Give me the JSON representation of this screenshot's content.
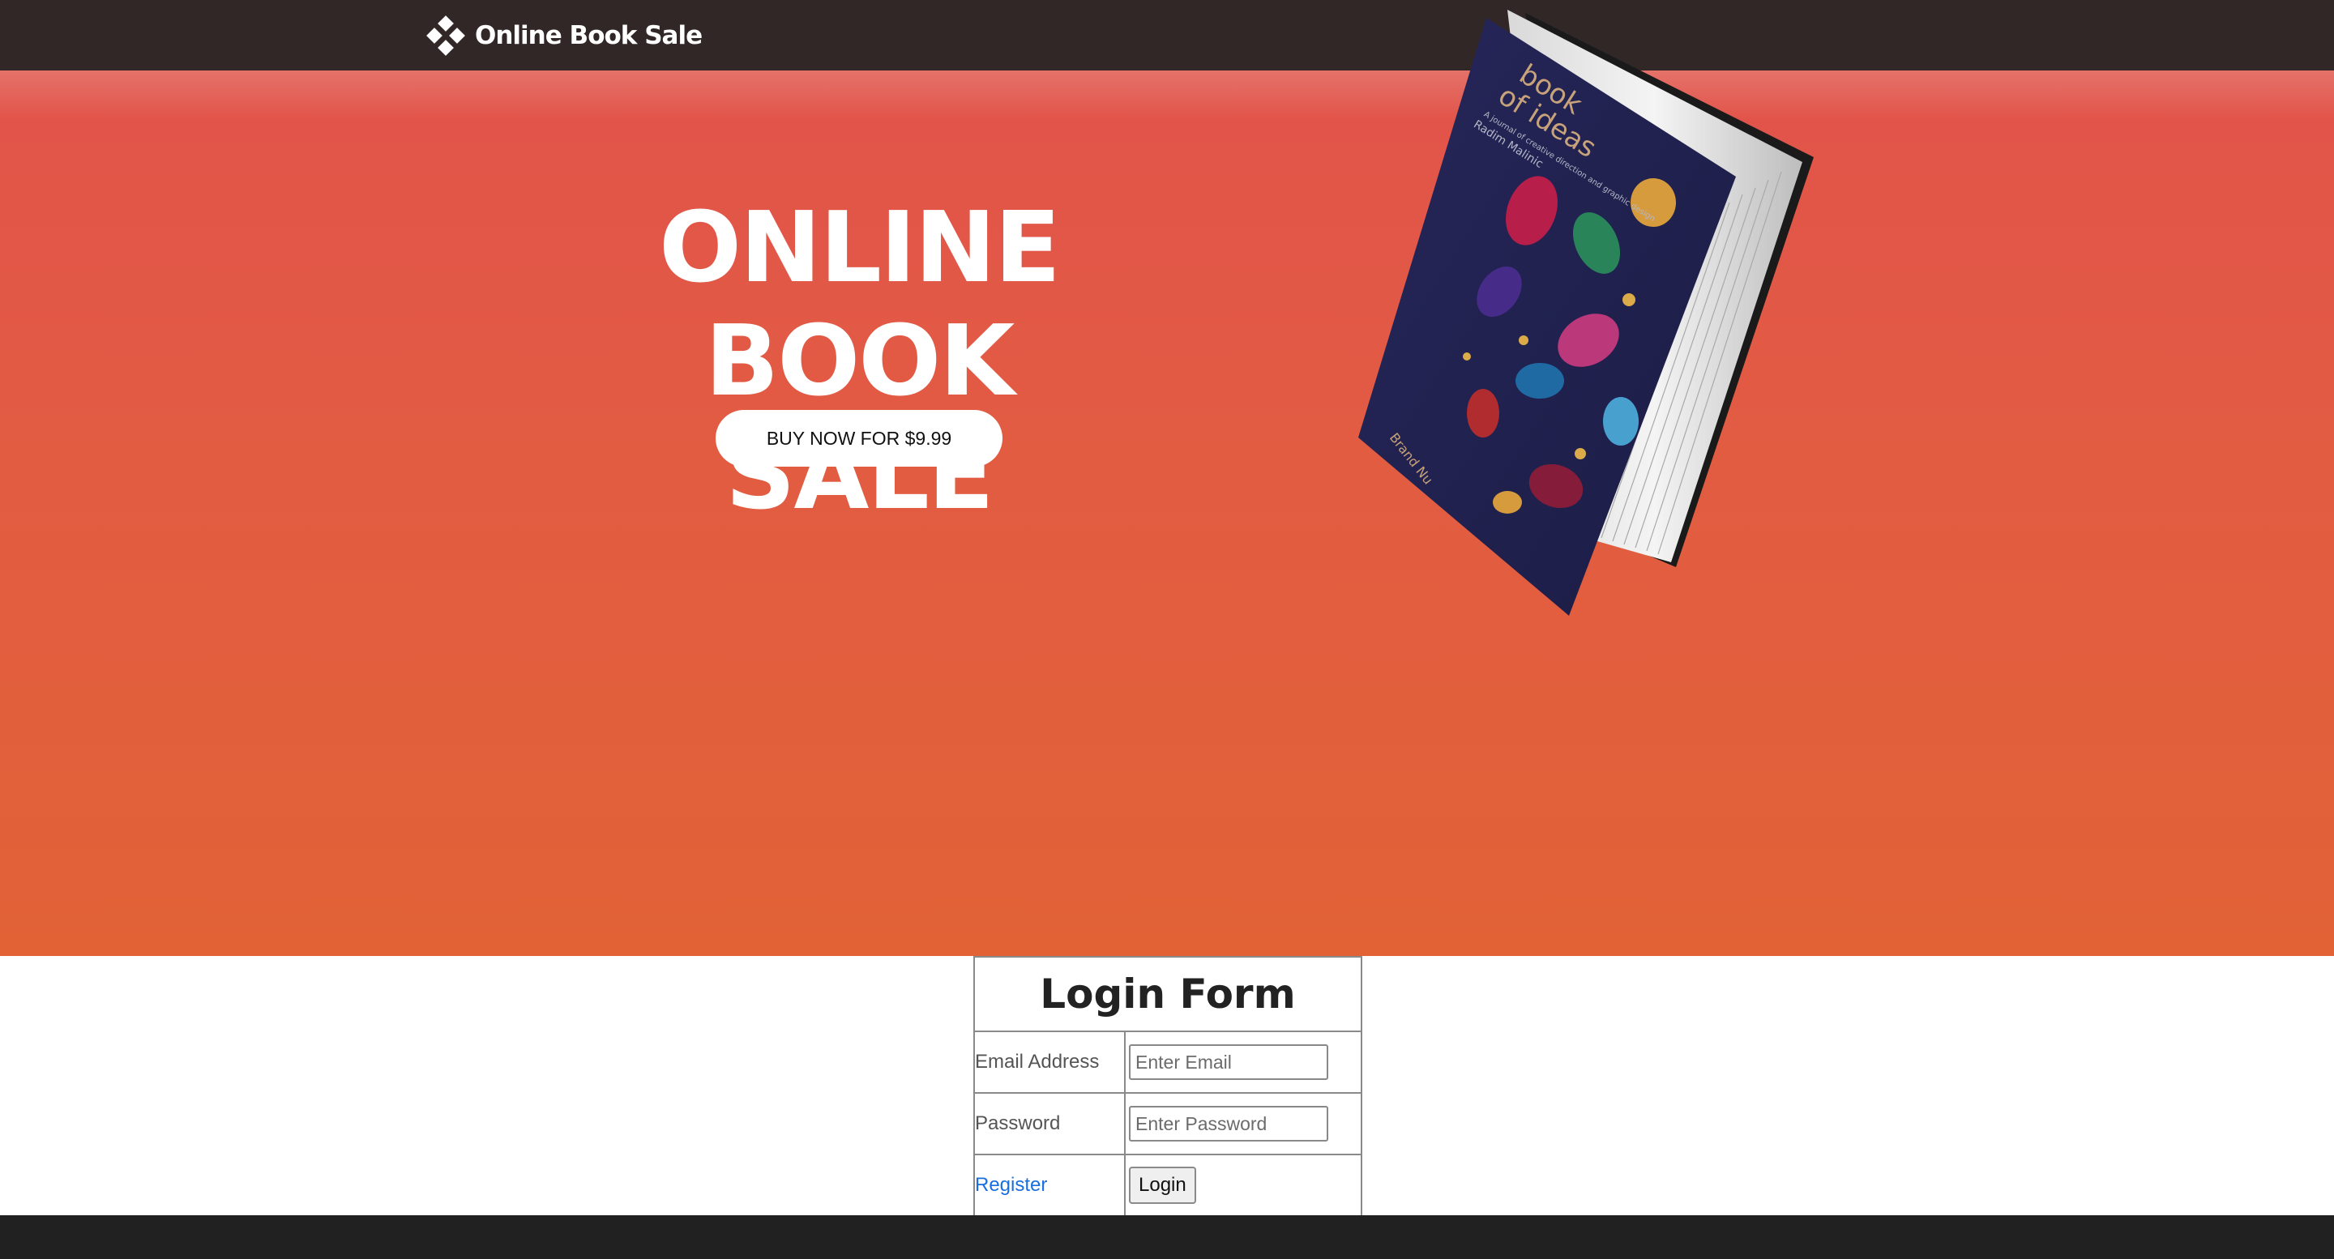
{
  "navbar": {
    "brand_name": "Online Book Sale",
    "logo_icon": "diamond-cluster-icon"
  },
  "hero": {
    "title_line1": "ONLINE BOOK",
    "title_line2": "SALE",
    "buy_button_label": "BUY NOW FOR $9.99",
    "book": {
      "cover_title_line1": "book",
      "cover_title_line2": "of ideas",
      "cover_subtitle": "A journal of creative direction and graphic design",
      "cover_author": "Radim Malinic",
      "cover_publisher": "Brand Nu"
    }
  },
  "login_form": {
    "title": "Login Form",
    "email_label": "Email Address",
    "email_placeholder": "Enter Email",
    "password_label": "Password",
    "password_placeholder": "Enter Password",
    "register_label": "Register",
    "login_button_label": "Login"
  },
  "colors": {
    "navbar": "#312727",
    "hero_top": "#e2534b",
    "hero_bottom": "#e26236",
    "footer": "#212121",
    "link": "#1a6fe0"
  }
}
